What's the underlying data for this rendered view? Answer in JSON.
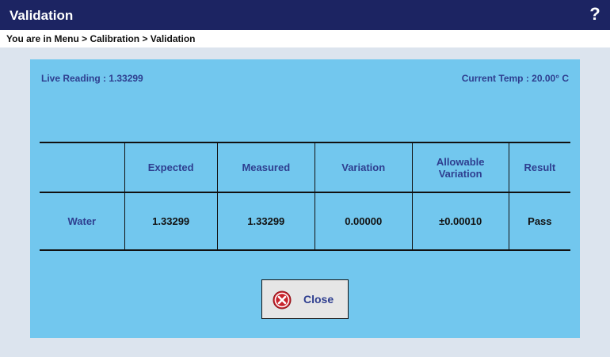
{
  "titlebar": {
    "title": "Validation",
    "help": "?"
  },
  "breadcrumb": {
    "text": "You are in Menu > Calibration > Validation"
  },
  "status": {
    "live_reading": "Live Reading : 1.33299",
    "current_temp": "Current Temp : 20.00° C"
  },
  "table": {
    "headers": [
      "",
      "Expected",
      "Measured",
      "Variation",
      "Allowable Variation",
      "Result"
    ],
    "rows": [
      {
        "sample": "Water",
        "expected": "1.33299",
        "measured": "1.33299",
        "variation": "0.00000",
        "allowable": "±0.00010",
        "result": "Pass"
      }
    ]
  },
  "close_button": {
    "label": "Close",
    "icon": "close-circle-icon"
  },
  "colors": {
    "titlebar": "#1c2462",
    "panel": "#72c7ee",
    "background": "#dce4ee",
    "accent_text": "#2e3e8f",
    "close_icon": "#c8232c"
  }
}
